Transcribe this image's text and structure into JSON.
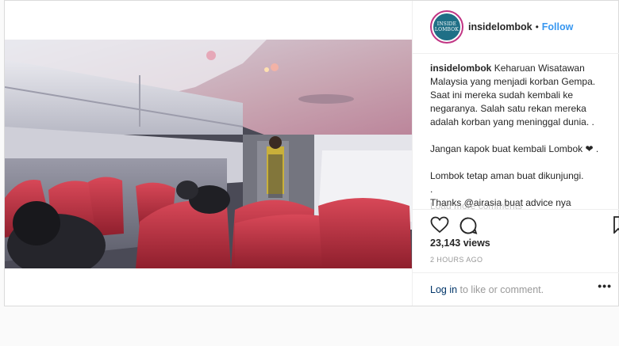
{
  "post": {
    "username": "insidelombok",
    "follow_label": "Follow",
    "separator": "•",
    "avatar_text": "INSIDE LOMBOK",
    "caption": {
      "username": "insidelombok",
      "lines": [
        "Keharuan Wisatawan Malaysia yang menjadi korban Gempa. Saat ini mereka sudah kembali ke negaranya. Salah satu rekan mereka adalah korban yang meninggal dunia. .",
        "",
        "Jangan kapok buat kembali Lombok ❤ .",
        "",
        "Lombok tetap aman buat dikunjungi.",
        ".",
        "Thanks @airasia buat advice nya"
      ]
    },
    "load_more": "Load more comments",
    "views": "23,143 views",
    "time_ago": "2 HOURS AGO",
    "comment_prompt": {
      "login": "Log in",
      "rest": " to like or comment."
    },
    "more_label": "•••"
  },
  "icons": [
    "heart-icon",
    "comment-icon",
    "bookmark-icon",
    "more-options-icon"
  ]
}
